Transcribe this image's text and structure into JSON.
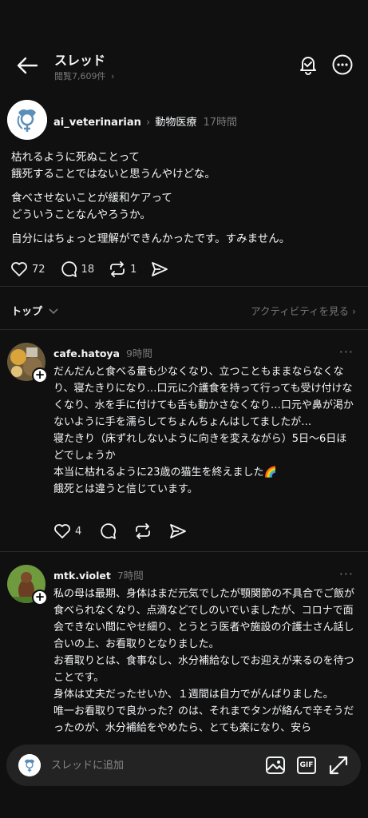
{
  "header": {
    "title": "スレッド",
    "views": "閲覧7,609件",
    "views_chevron": "›"
  },
  "post": {
    "username": "ai_veterinarian",
    "topic_chevron": "›",
    "topic": "動物医療",
    "time": "17時間",
    "paragraphs": [
      "枯れるように死ぬことって\n餓死することではないと思うんやけどな。",
      "食べさせないことが緩和ケアって\nどういうことなんやろうか。",
      "自分にはちょっと理解ができんかったです。すみません。"
    ],
    "likes": "72",
    "comments": "18",
    "reposts": "1"
  },
  "sortbar": {
    "label": "トップ",
    "activity_link": "アクティビティを見る ›"
  },
  "replies": [
    {
      "username": "cafe.hatoya",
      "time": "9時間",
      "more": "···",
      "text": "だんだんと食べる量も少なくなり、立つこともままならなくなり、寝たきりになり…口元に介護食を持って行っても受け付けなくなり、水を手に付けても舌も動かさなくなり…口元や鼻が渇かないように手を濡らしてちょんちょんはしてましたが…\n寝たきり（床ずれしないように向きを変えながら）5日〜6日ほどでしょうか\n本当に枯れるように23歳の猫生を終えました🌈\n餓死とは違うと信じています。",
      "likes": "4"
    },
    {
      "username": "mtk.violet",
      "time": "7時間",
      "more": "···",
      "text": "私の母は最期、身体はまだ元気でしたが顎関節の不具合でご飯が食べられなくなり、点滴などでしのいでいましたが、コロナで面会できない間にやせ細り、とうとう医者や施設の介護士さん話し合いの上、お看取りとなりました。\nお看取りとは、食事なし、水分補給なしでお迎えが来るのを待つことです。\n身体は丈夫だったせいか、１週間は自力でがんばりました。\n唯一お看取りで良かった？のは、それまでタンが絡んで辛そうだったのが、水分補給をやめたら、とても楽になり、安ら"
    }
  ],
  "composer": {
    "placeholder": "スレッドに追加",
    "gif_label": "GIF"
  },
  "icons": {
    "back": "arrow-left-icon",
    "bell": "bell-icon",
    "more": "more-icon",
    "heart": "heart-icon",
    "comment": "comment-icon",
    "repost": "repost-icon",
    "share": "send-icon",
    "image": "image-icon",
    "gif": "gif-icon",
    "expand": "expand-icon"
  }
}
